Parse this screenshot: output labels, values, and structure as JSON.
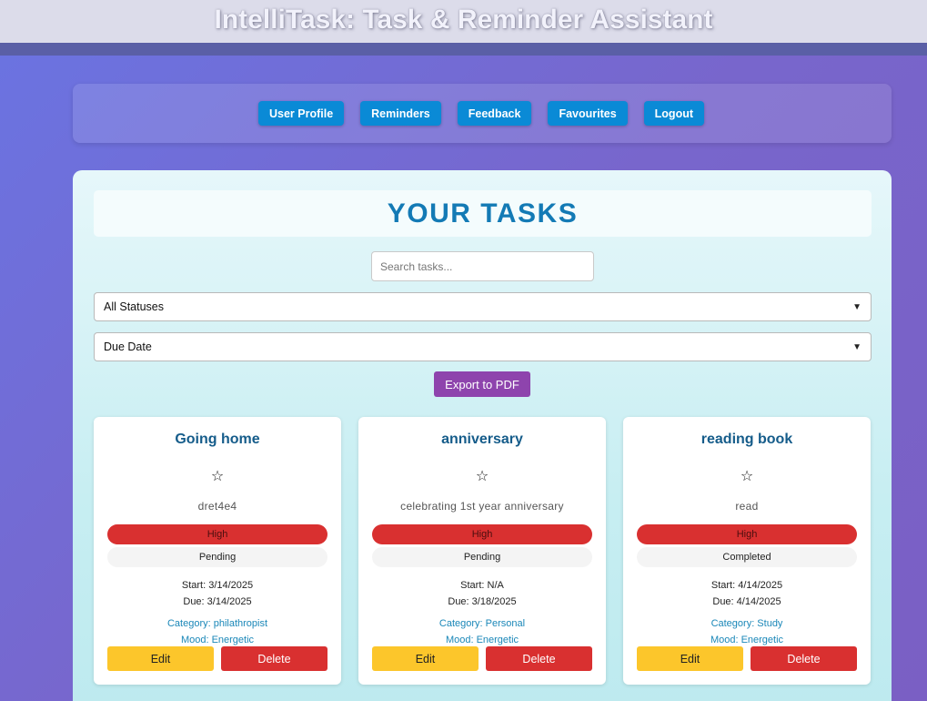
{
  "header": {
    "title": "IntelliTask: Task & Reminder Assistant"
  },
  "nav": {
    "items": [
      {
        "label": "User Profile"
      },
      {
        "label": "Reminders"
      },
      {
        "label": "Feedback"
      },
      {
        "label": "Favourites"
      },
      {
        "label": "Logout"
      }
    ]
  },
  "main": {
    "title": "YOUR TASKS",
    "search": {
      "placeholder": "Search tasks...",
      "value": ""
    },
    "status_filter": {
      "selected": "All Statuses"
    },
    "sort_select": {
      "selected": "Due Date"
    },
    "export_label": "Export to PDF"
  },
  "tasks": [
    {
      "title": "Going home",
      "favourite_icon": "☆",
      "description": "dret4e4",
      "priority": "High",
      "status": "Pending",
      "start": "Start: 3/14/2025",
      "due": "Due: 3/14/2025",
      "category": "Category: philathropist",
      "mood": "Mood: Energetic",
      "edit_label": "Edit",
      "delete_label": "Delete"
    },
    {
      "title": "anniversary",
      "favourite_icon": "☆",
      "description": "celebrating 1st year anniversary",
      "priority": "High",
      "status": "Pending",
      "start": "Start: N/A",
      "due": "Due: 3/18/2025",
      "category": "Category: Personal",
      "mood": "Mood: Energetic",
      "edit_label": "Edit",
      "delete_label": "Delete"
    },
    {
      "title": "reading book",
      "favourite_icon": "☆",
      "description": "read",
      "priority": "High",
      "status": "Completed",
      "start": "Start: 4/14/2025",
      "due": "Due: 4/14/2025",
      "category": "Category: Study",
      "mood": "Mood: Energetic",
      "edit_label": "Edit",
      "delete_label": "Delete"
    }
  ],
  "icons": {
    "favourite": "star-outline-icon",
    "select_arrow": "chevron-down-icon"
  },
  "colors": {
    "nav_button": "#0a8ad6",
    "export_button": "#8e44ad",
    "priority_high": "#d93030",
    "edit_button": "#fcc62b",
    "delete_button": "#d93030",
    "title_text": "#137ab5"
  }
}
